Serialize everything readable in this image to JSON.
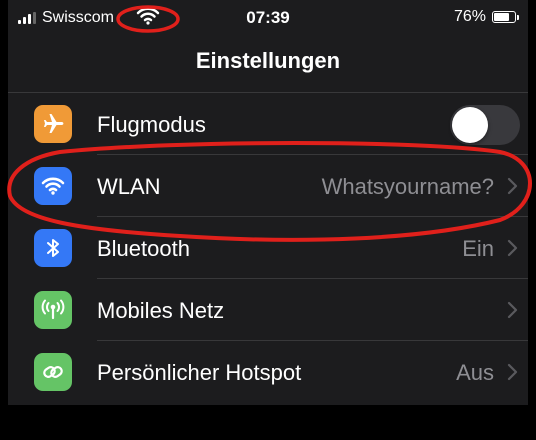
{
  "status_bar": {
    "carrier": "Swisscom",
    "time": "07:39",
    "battery_text": "76%",
    "battery_level": 0.76,
    "signal_bars": 3
  },
  "nav": {
    "title": "Einstellungen"
  },
  "rows": [
    {
      "label": "Flugmodus",
      "icon": "airplane-icon",
      "icon_color": "#f09a37",
      "toggle_on": false
    },
    {
      "label": "WLAN",
      "value": "Whatsyourname?",
      "icon": "wifi-icon",
      "icon_color": "#3478f6"
    },
    {
      "label": "Bluetooth",
      "value": "Ein",
      "icon": "bluetooth-icon",
      "icon_color": "#3478f6"
    },
    {
      "label": "Mobiles Netz",
      "value": "",
      "icon": "antenna-icon",
      "icon_color": "#65c466"
    },
    {
      "label": "Persönlicher Hotspot",
      "value": "Aus",
      "icon": "hotspot-icon",
      "icon_color": "#65c466"
    }
  ],
  "annotation_color": "#e0201b"
}
